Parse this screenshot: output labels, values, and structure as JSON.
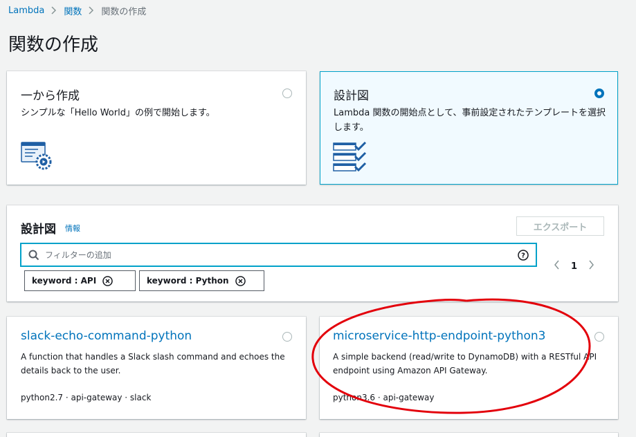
{
  "breadcrumb": {
    "items": [
      "Lambda",
      "関数",
      "関数の作成"
    ]
  },
  "page_title": "関数の作成",
  "options": {
    "scratch": {
      "title": "一から作成",
      "desc": "シンプルな「Hello World」の例で開始します。",
      "selected": false
    },
    "blueprint": {
      "title": "設計図",
      "desc": "Lambda 関数の開始点として、事前設定されたテンプレートを選択します。",
      "selected": true
    }
  },
  "blueprints_panel": {
    "title": "設計図",
    "info_link": "情報",
    "export_label": "エクスポート",
    "search_placeholder": "フィルターの追加",
    "tokens": [
      "keyword : API",
      "keyword : Python"
    ],
    "page_number": "1"
  },
  "templates": [
    {
      "name": "slack-echo-command-python",
      "desc": "A function that handles a Slack slash command and echoes the details back to the user.",
      "tags": "python2.7 · api-gateway · slack"
    },
    {
      "name": "microservice-http-endpoint-python3",
      "desc": "A simple backend (read/write to DynamoDB) with a RESTful API endpoint using Amazon API Gateway.",
      "tags": "python3.6 · api-gateway"
    }
  ],
  "colors": {
    "link": "#0073bb",
    "selected_border": "#00a1c9",
    "annotation": "#e3000b"
  }
}
